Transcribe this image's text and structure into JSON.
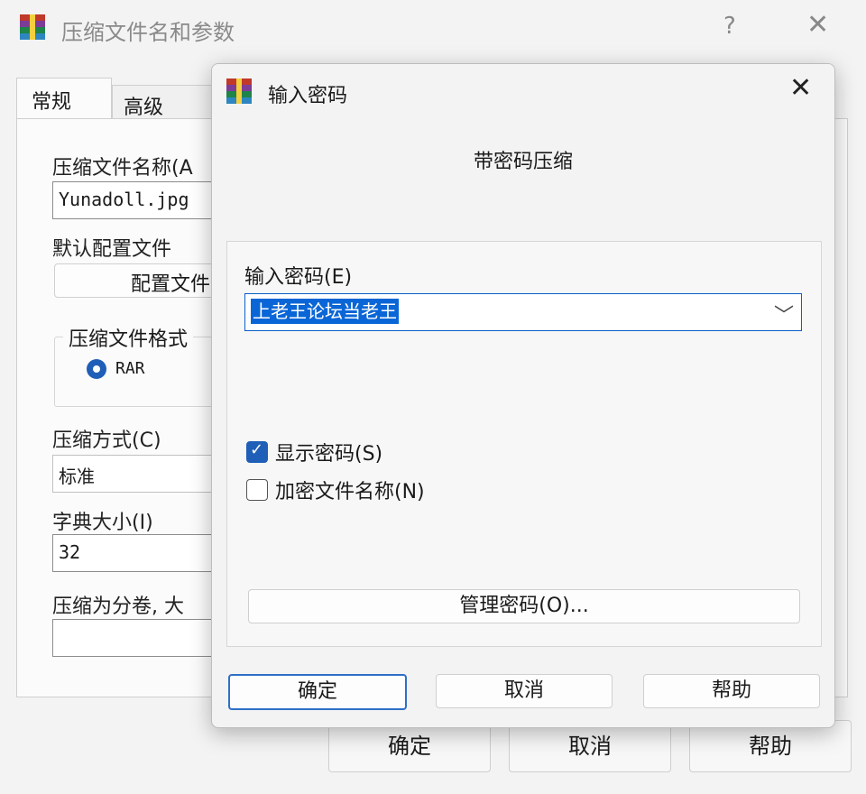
{
  "back_window": {
    "title": "压缩文件名和参数",
    "help_glyph": "?",
    "close_glyph": "✕",
    "tabs": [
      {
        "label": "常规",
        "active": true
      },
      {
        "label": "高级",
        "active": false
      }
    ],
    "archive_name_label": "压缩文件名称(A",
    "archive_name_value": "Yunadoll.jpg",
    "default_profile_label": "默认配置文件",
    "profile_button_label": "配置文件",
    "format_group_label": "压缩文件格式",
    "format_option_rar": "RAR",
    "method_label": "压缩方式(C)",
    "method_value": "标准",
    "dict_label": "字典大小(I)",
    "dict_value": "32",
    "split_label": "压缩为分卷, 大",
    "split_value": "",
    "buttons": {
      "ok": "确定",
      "cancel": "取消",
      "help": "帮助"
    }
  },
  "dialog": {
    "title": "输入密码",
    "close_glyph": "✕",
    "heading": "带密码压缩",
    "password_label": "输入密码(E)",
    "password_value": "上老王论坛当老王",
    "dropdown_glyph": "﹀",
    "show_password_label": "显示密码(S)",
    "show_password_checked": true,
    "encrypt_names_label": "加密文件名称(N)",
    "encrypt_names_checked": false,
    "manage_button_label": "管理密码(O)...",
    "buttons": {
      "ok": "确定",
      "cancel": "取消",
      "help": "帮助"
    }
  },
  "colors": {
    "accent": "#1f5fb7",
    "selection": "#0a66d6"
  }
}
